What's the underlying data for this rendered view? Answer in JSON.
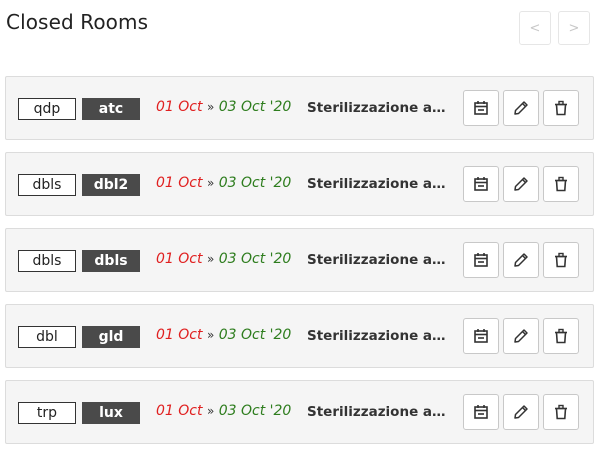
{
  "header": {
    "title": "Closed Rooms",
    "prev_label": "<",
    "next_label": ">"
  },
  "closures": [
    {
      "room": "qdp",
      "type": "atc",
      "from": "01 Oct",
      "separator": "»",
      "to": "03 Oct '20",
      "reason": "Sterilizzazione am…"
    },
    {
      "room": "dbls",
      "type": "dbl2",
      "from": "01 Oct",
      "separator": "»",
      "to": "03 Oct '20",
      "reason": "Sterilizzazione am…"
    },
    {
      "room": "dbls",
      "type": "dbls",
      "from": "01 Oct",
      "separator": "»",
      "to": "03 Oct '20",
      "reason": "Sterilizzazione am…"
    },
    {
      "room": "dbl",
      "type": "gld",
      "from": "01 Oct",
      "separator": "»",
      "to": "03 Oct '20",
      "reason": "Sterilizzazione am…"
    },
    {
      "room": "trp",
      "type": "lux",
      "from": "01 Oct",
      "separator": "»",
      "to": "03 Oct '20",
      "reason": "Sterilizzazione am…"
    }
  ],
  "icons": {
    "calendar": "calendar-icon",
    "edit": "pencil-icon",
    "delete": "trash-icon"
  },
  "colors": {
    "date_from": "#e02020",
    "date_to": "#2e7d1e",
    "type_tag_bg": "#4a4a4a",
    "row_bg": "#f5f5f5"
  }
}
